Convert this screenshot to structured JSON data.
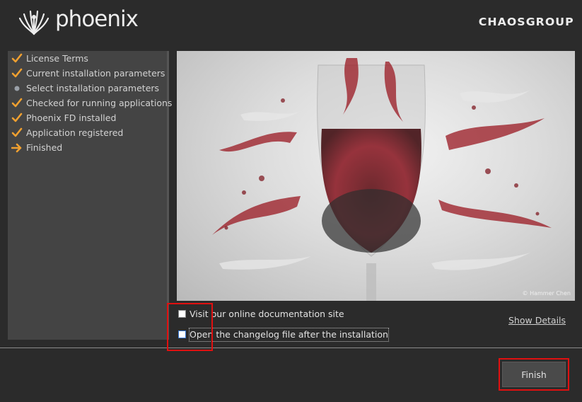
{
  "header": {
    "product_name": "phoenix",
    "brand": "CHAOSGROUP"
  },
  "steps": [
    {
      "label": "License Terms",
      "state": "done"
    },
    {
      "label": "Current installation parameters",
      "state": "done"
    },
    {
      "label": "Select installation parameters",
      "state": "skipped"
    },
    {
      "label": "Checked for running applications",
      "state": "done"
    },
    {
      "label": "Phoenix FD installed",
      "state": "done"
    },
    {
      "label": "Application registered",
      "state": "done"
    },
    {
      "label": "Finished",
      "state": "current"
    }
  ],
  "image": {
    "credit": "© Hammer Chen"
  },
  "options": {
    "visit_docs_label": "Visit our online documentation site",
    "visit_docs_checked": false,
    "changelog_label": "Open the changelog file after the installation",
    "changelog_checked": false
  },
  "show_details_label": "Show Details",
  "finish_label": "Finish",
  "colors": {
    "background": "#2b2b2b",
    "sidebar": "#444444",
    "check_orange": "#f0a030",
    "highlight_red": "#e01010"
  }
}
